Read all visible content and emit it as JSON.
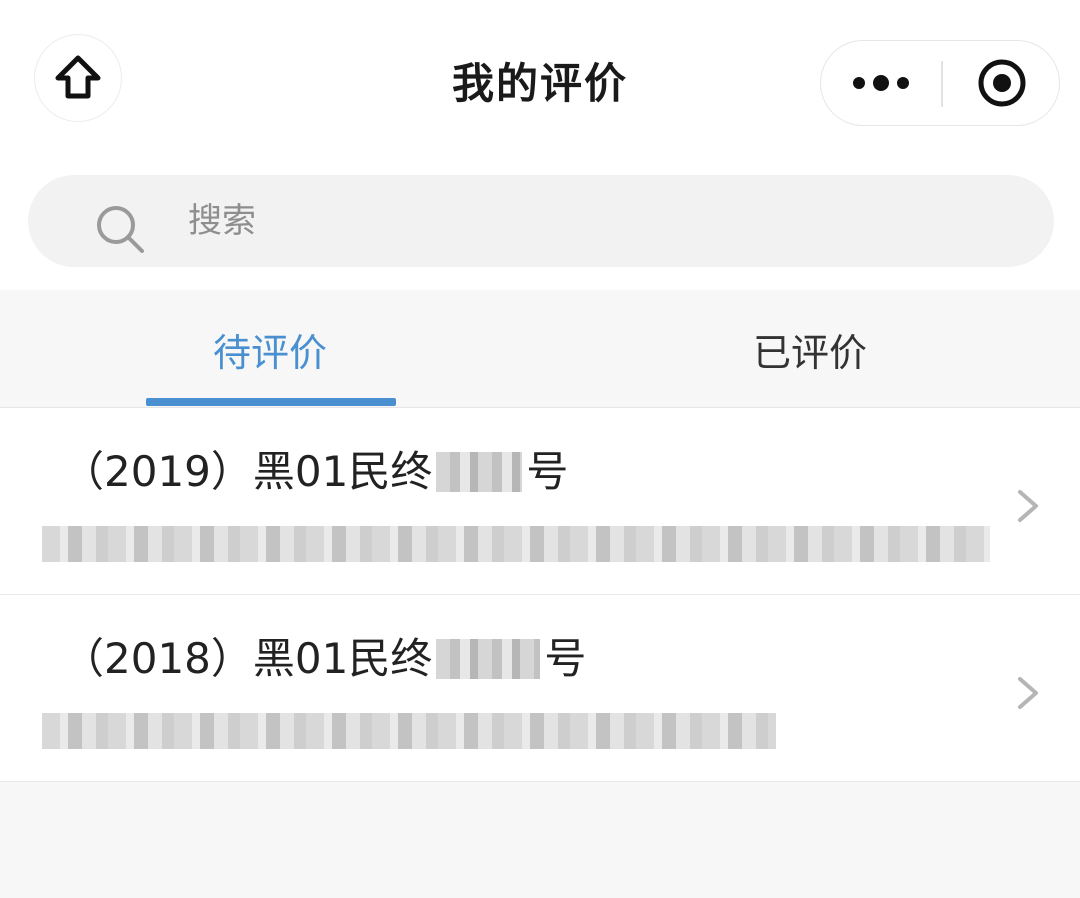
{
  "nav": {
    "title": "我的评价",
    "icons": {
      "home": "home-icon",
      "more": "more-dots-icon",
      "close": "close-target-icon"
    }
  },
  "search": {
    "placeholder": "搜索",
    "icon": "search-icon"
  },
  "tabs": [
    {
      "label": "待评价",
      "active": true
    },
    {
      "label": "已评价",
      "active": false
    }
  ],
  "items": [
    {
      "title_prefix": "（2019）黑01民终",
      "title_suffix": "号"
    },
    {
      "title_prefix": "（2018）黑01民终",
      "title_suffix": "号"
    }
  ],
  "colors": {
    "accent": "#4a90d0",
    "text": "#1a1a1a",
    "background": "#f7f7f7"
  }
}
